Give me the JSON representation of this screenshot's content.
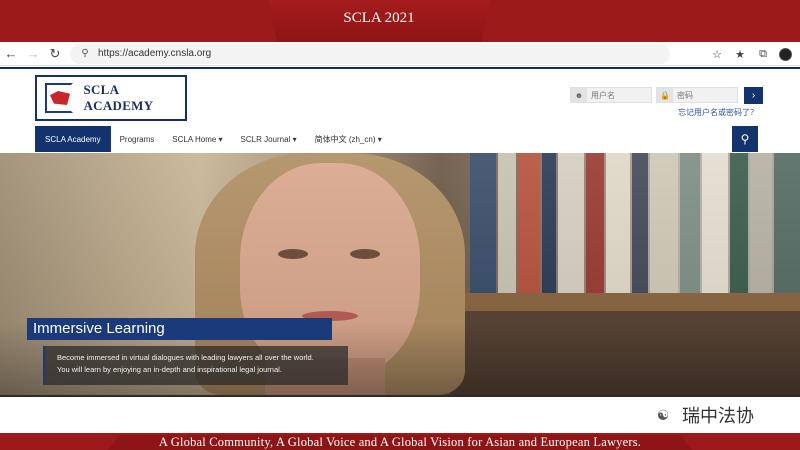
{
  "slide": {
    "header_title": "SCLA 2021",
    "footer_tagline": "A Global  Community,  A Global  Voice and A Global  Vision  for Asian and European  Lawyers.",
    "wechat_label": "瑞中法协"
  },
  "browser": {
    "url": "https://academy.cnsla.org",
    "icons": [
      "back-icon",
      "forward-icon",
      "reload-icon",
      "lock-icon",
      "favorite-add-icon",
      "favorites-icon",
      "collections-icon",
      "profile-icon"
    ]
  },
  "site": {
    "logo_text": "SCLA ACADEMY",
    "username_placeholder": "用户名",
    "password_placeholder": "密码",
    "login_arrow": "›",
    "forgot_text": "忘记用户名或密码了？",
    "nav": [
      {
        "label": "SCLA Academy",
        "active": true
      },
      {
        "label": "Programs"
      },
      {
        "label": "SCLA Home ▾"
      },
      {
        "label": "SCLR Journal ▾"
      },
      {
        "label": "简体中文 (zh_cn) ▾"
      }
    ]
  },
  "hero": {
    "title": "Immersive Learning",
    "description_line1": "Become immersed in virtual dialogues with leading lawyers all over the world.",
    "description_line2": "You will learn by enjoying an in-depth and inspirational legal journal."
  },
  "colors": {
    "banner_red": "#9c1a1a",
    "navy": "#12336e",
    "hero_title_bg": "#1a3a7a"
  }
}
